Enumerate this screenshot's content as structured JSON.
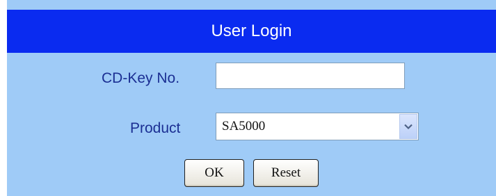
{
  "header": {
    "title": "User Login"
  },
  "form": {
    "cdkey_label": "CD-Key No.",
    "cdkey_value": "",
    "product_label": "Product",
    "product_selected": "SA5000"
  },
  "buttons": {
    "ok": "OK",
    "reset": "Reset"
  },
  "icons": {
    "dropdown": "chevron-down-icon"
  },
  "colors": {
    "header_bg": "#0a2bf0",
    "panel_bg": "#9fcbf7",
    "label_text": "#1b2f93"
  }
}
